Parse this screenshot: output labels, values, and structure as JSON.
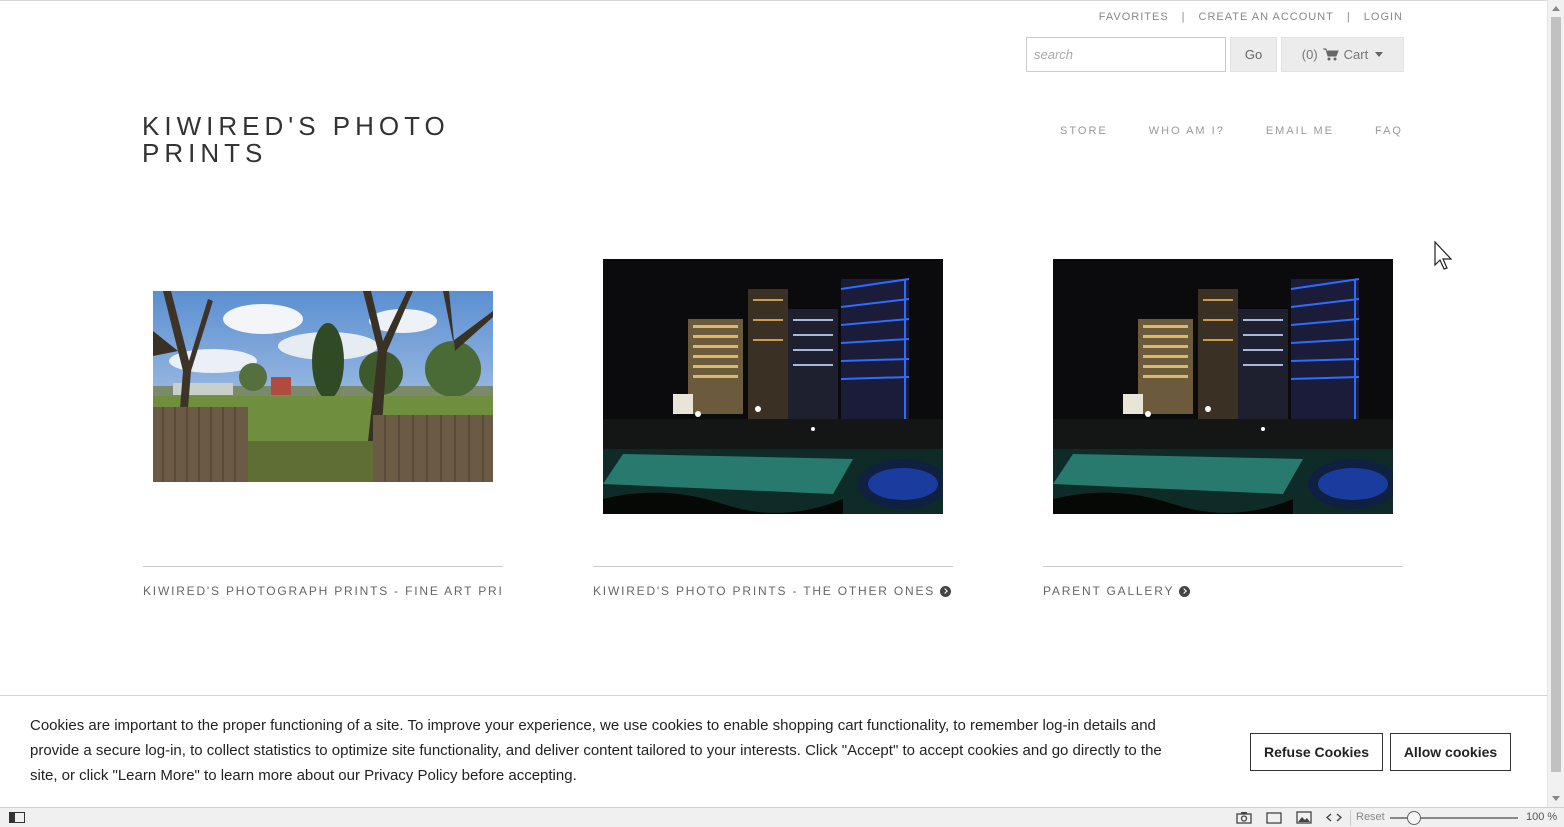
{
  "header": {
    "util_links": [
      "FAVORITES",
      "CREATE AN ACCOUNT",
      "LOGIN"
    ],
    "search_placeholder": "search",
    "go_label": "Go",
    "cart_count": "(0)",
    "cart_label": "Cart",
    "logo_text": "KIWIRED'S PHOTO PRINTS",
    "nav": [
      "STORE",
      "WHO AM I?",
      "EMAIL ME",
      "FAQ"
    ]
  },
  "gallery": {
    "items": [
      {
        "caption": "KIWIRED'S PHOTOGRAPH PRINTS - FINE ART PRI...",
        "has_arrow": false,
        "image": "tree-field-photo"
      },
      {
        "caption": "KIWIRED'S PHOTO PRINTS - THE OTHER ONES",
        "has_arrow": true,
        "image": "night-city-pool-photo"
      },
      {
        "caption": "PARENT GALLERY",
        "has_arrow": true,
        "image": "night-city-pool-photo"
      }
    ]
  },
  "cookie_banner": {
    "text": "Cookies are important to the proper functioning of a site. To improve your experience, we use cookies to enable shopping cart functionality, to remember log-in details and provide a secure log-in, to collect statistics to optimize site functionality, and deliver content tailored to your interests. Click \"Accept\" to accept cookies and go directly to the site, or click \"Learn More\" to learn more about our Privacy Policy before accepting.",
    "refuse_label": "Refuse Cookies",
    "allow_label": "Allow cookies"
  },
  "statusbar": {
    "reset_label": "Reset",
    "zoom": "100 %"
  },
  "colors": {
    "text_dark": "#333333",
    "nav_gray": "#999999",
    "button_bg": "#ececec"
  }
}
